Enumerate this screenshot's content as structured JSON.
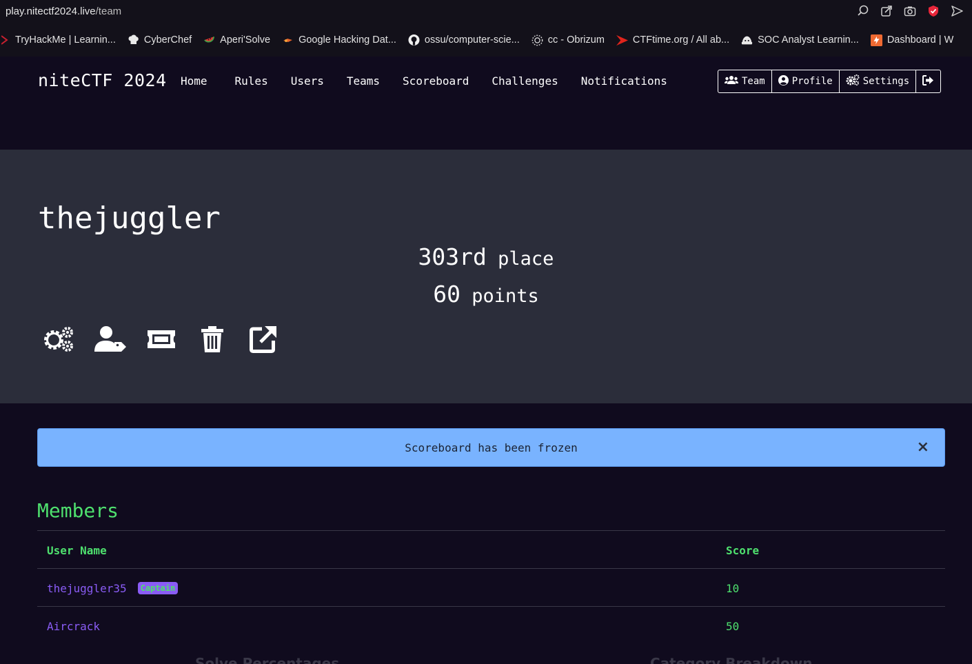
{
  "browser": {
    "url_host": "play.nitectf2024.live",
    "url_path": "/team",
    "icons": [
      "zoom-icon",
      "share-icon",
      "screenshot-icon",
      "shield-icon",
      "send-icon"
    ],
    "bookmarks": [
      {
        "label": "TryHackMe | Learnin...",
        "icon": "tryhackme-icon"
      },
      {
        "label": "CyberChef",
        "icon": "chef-hat-icon"
      },
      {
        "label": "Aperi'Solve",
        "icon": "watermelon-icon"
      },
      {
        "label": "Google Hacking Dat...",
        "icon": "exploit-db-icon"
      },
      {
        "label": "ossu/computer-scie...",
        "icon": "github-icon"
      },
      {
        "label": "cc - Obrizum",
        "icon": "obrizum-icon"
      },
      {
        "label": "CTFtime.org / All ab...",
        "icon": "ctftime-icon"
      },
      {
        "label": "SOC Analyst Learnin...",
        "icon": "soc-icon"
      },
      {
        "label": "Dashboard | W",
        "icon": "dashboard-icon"
      }
    ]
  },
  "nav": {
    "brand": "niteCTF 2024",
    "links": [
      "Home",
      "Rules",
      "Users",
      "Teams",
      "Scoreboard",
      "Challenges",
      "Notifications"
    ],
    "buttons": {
      "team": "Team",
      "profile": "Profile",
      "settings": "Settings"
    }
  },
  "team": {
    "name": "thejuggler",
    "place_num": "303rd",
    "place_label": "place",
    "points_num": "60",
    "points_label": "points",
    "actions": [
      "settings-icon",
      "user-tag-icon",
      "ticket-icon",
      "trash-icon",
      "external-link-icon"
    ]
  },
  "alert": {
    "text": "Scoreboard has been frozen",
    "close": "×"
  },
  "members": {
    "title": "Members",
    "headers": {
      "user": "User Name",
      "score": "Score"
    },
    "rows": [
      {
        "user": "thejuggler35",
        "badge": "Captain",
        "score": "10"
      },
      {
        "user": "Aircrack",
        "badge": "",
        "score": "50"
      }
    ]
  },
  "below_fold": {
    "left": "Solve Percentages",
    "right": "Category Breakdown"
  },
  "colors": {
    "page_bg": "#100b1e",
    "jumbotron_bg": "#2b2d3a",
    "accent_green": "#4ee06e",
    "accent_purple": "#8a5cf5",
    "alert_bg": "#79b3ff"
  }
}
